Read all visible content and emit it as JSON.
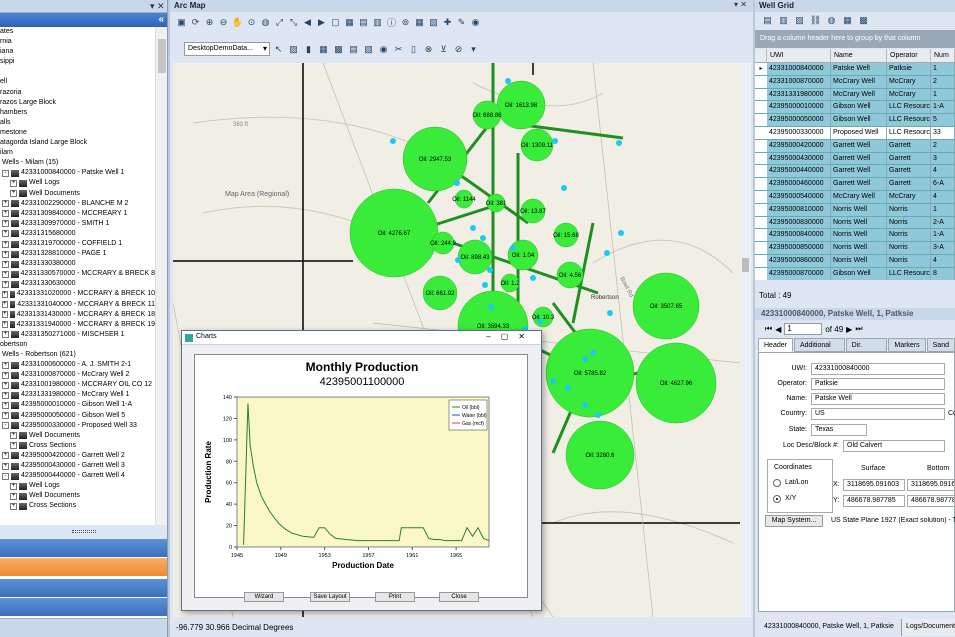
{
  "left_panel": {
    "tree_items": [
      {
        "text": "ates",
        "level": 0
      },
      {
        "text": "rnia",
        "level": 0
      },
      {
        "text": "iana",
        "level": 0
      },
      {
        "text": "sippi",
        "level": 0
      },
      {
        "text": "",
        "level": 0
      },
      {
        "text": "ell",
        "level": 0
      },
      {
        "text": "razoria",
        "level": 0
      },
      {
        "text": "razos Large Block",
        "level": 0
      },
      {
        "text": "hambers",
        "level": 0
      },
      {
        "text": "alls",
        "level": 0
      },
      {
        "text": "mestone",
        "level": 0
      },
      {
        "text": "atagorda Island Large Block",
        "level": 0
      },
      {
        "text": "ilam",
        "level": 0
      },
      {
        "text": "Wells - Milam (15)",
        "level": 1
      },
      {
        "text": "42331000840000 - Patske Well 1",
        "level": 1,
        "exp": "-"
      },
      {
        "text": "Well Logs",
        "level": 2,
        "exp": "+"
      },
      {
        "text": "Well Documents",
        "level": 2,
        "exp": "+"
      },
      {
        "text": "42331002290000 - BLANCHE M 2",
        "level": 1,
        "exp": "+"
      },
      {
        "text": "42331309840000 - MCCREARY 1",
        "level": 1,
        "exp": "+"
      },
      {
        "text": "42331309970000 - SMITH 1",
        "level": 1,
        "exp": "+"
      },
      {
        "text": "42331315680000",
        "level": 1,
        "exp": "+"
      },
      {
        "text": "42331319700000 - COFFIELD 1",
        "level": 1,
        "exp": "+"
      },
      {
        "text": "42331328810000 - PAGE 1",
        "level": 1,
        "exp": "+"
      },
      {
        "text": "42331330380000",
        "level": 1,
        "exp": "+"
      },
      {
        "text": "42331330570000 - MCCRARY & BRECK 8",
        "level": 1,
        "exp": "+"
      },
      {
        "text": "42331330630000",
        "level": 1,
        "exp": "+"
      },
      {
        "text": "42331331020000 - MCCRARY & BRECK 10",
        "level": 1,
        "exp": "+"
      },
      {
        "text": "42331331040000 - MCCRARY & BRECK 11",
        "level": 1,
        "exp": "+"
      },
      {
        "text": "42331331430000 - MCCRARY & BRECK 18",
        "level": 1,
        "exp": "+"
      },
      {
        "text": "42331331940000 - MCCRARY & BRECK 19",
        "level": 1,
        "exp": "+"
      },
      {
        "text": "42331350271000 - MISCHSER 1",
        "level": 1,
        "exp": "+"
      },
      {
        "text": "obertson",
        "level": 0
      },
      {
        "text": "Wells - Robertson (621)",
        "level": 1
      },
      {
        "text": "42331000600000 - A. J. SMITH 2-1",
        "level": 1,
        "exp": "+"
      },
      {
        "text": "42331000870000 - McCrary Well 2",
        "level": 1,
        "exp": "+"
      },
      {
        "text": "42331001980000 - MCCRARY OIL CO 12",
        "level": 1,
        "exp": "+"
      },
      {
        "text": "42331331980000 - McCrary Well 1",
        "level": 1,
        "exp": "+"
      },
      {
        "text": "42395000010000 - Gibson Well 1-A",
        "level": 1,
        "exp": "+"
      },
      {
        "text": "42395000050000 - Gibson Well 5",
        "level": 1,
        "exp": "+"
      },
      {
        "text": "42395000330000 - Proposed Well 33",
        "level": 1,
        "exp": "-"
      },
      {
        "text": "Well Documents",
        "level": 2,
        "exp": "+"
      },
      {
        "text": "Cross Sections",
        "level": 2,
        "exp": "+"
      },
      {
        "text": "42395000420000 - Garrett Well 2",
        "level": 1,
        "exp": "+"
      },
      {
        "text": "42395000430000 - Garrett Well 3",
        "level": 1,
        "exp": "+"
      },
      {
        "text": "42395000440000 - Garrett Well 4",
        "level": 1,
        "exp": "-"
      },
      {
        "text": "Well Logs",
        "level": 2,
        "exp": "+"
      },
      {
        "text": "Well Documents",
        "level": 2,
        "exp": "+"
      },
      {
        "text": "Cross Sections",
        "level": 2,
        "exp": "+"
      }
    ]
  },
  "map": {
    "title": "Arc Map",
    "layer_select": "DesktopDemoData...",
    "area_label": "Map Area (Regional)",
    "status": "-96.779 30.966 Decimal Degrees",
    "place_label": "Robertson",
    "road_labels": [
      "383 ft",
      "Bowl Rd"
    ],
    "bubbles": [
      {
        "label": "Oil: 1613.98",
        "r": 24
      },
      {
        "label": "Oil: 688.86",
        "r": 14
      },
      {
        "label": "Oil: 2947.53",
        "r": 32
      },
      {
        "label": "Oil: 1309.11",
        "r": 16
      },
      {
        "label": "Oil: 4276.67",
        "r": 44
      },
      {
        "label": "Oil: 13.87",
        "r": 12
      },
      {
        "label": "Oil: 15.68",
        "r": 12
      },
      {
        "label": "Oil: 244.9",
        "r": 11
      },
      {
        "label": "Oil: 898.43",
        "r": 17
      },
      {
        "label": "Oil: 1.04",
        "r": 15
      },
      {
        "label": "Oil: 4.56",
        "r": 13
      },
      {
        "label": "Oil: 661.02",
        "r": 17
      },
      {
        "label": "Oil: 3507.65",
        "r": 33
      },
      {
        "label": "Oil: 3594.33",
        "r": 35
      },
      {
        "label": "Oil: 5785.82",
        "r": 44
      },
      {
        "label": "Oil: 4627.96",
        "r": 40
      },
      {
        "label": "Oil: 3260.6",
        "r": 34
      },
      {
        "label": "Oil: 1144",
        "r": 9
      },
      {
        "label": "Oil: 381",
        "r": 9
      },
      {
        "label": "Oil: 1.2",
        "r": 9
      },
      {
        "label": "Oil: 10.3",
        "r": 10
      }
    ]
  },
  "chart_window": {
    "title": "Charts",
    "buttons": [
      "Wizard",
      "Save Layout",
      "Print",
      "Close"
    ]
  },
  "chart_data": {
    "type": "line",
    "title": "Monthly Production",
    "subtitle": "42395001100000",
    "xlabel": "Production Date",
    "ylabel": "Production Rate",
    "xlim": [
      1945,
      1968
    ],
    "ylim": [
      0,
      140
    ],
    "x_ticks": [
      "1945",
      "1949",
      "1953",
      "1957",
      "1961",
      "1965"
    ],
    "y_ticks": [
      0,
      20,
      40,
      60,
      80,
      100,
      120,
      140
    ],
    "legend": [
      "Oil (bbl)",
      "Water (bbl)",
      "Gas (mcf)"
    ],
    "series": [
      {
        "name": "Oil (bbl)",
        "color": "#2e7d32",
        "x": [
          1945.6,
          1946.0,
          1946.2,
          1946.5,
          1946.8,
          1947.2,
          1947.6,
          1948,
          1948.5,
          1949,
          1949.5,
          1950,
          1951,
          1952,
          1952.5,
          1953,
          1953.5,
          1954,
          1955,
          1956,
          1957,
          1958,
          1959,
          1959.8,
          1960,
          1961,
          1961.5,
          1962,
          1962.5,
          1963,
          1963.5,
          1964,
          1964.5,
          1965,
          1965.5,
          1966,
          1966.5,
          1967,
          1967.5,
          1968
        ],
        "y": [
          2,
          134,
          95,
          75,
          60,
          48,
          40,
          33,
          26,
          20,
          16,
          13,
          10,
          9,
          18,
          18,
          12,
          8,
          7,
          6,
          6,
          6,
          6,
          6,
          18,
          18,
          18,
          18,
          8,
          7,
          7,
          6,
          6,
          6,
          6,
          18,
          10,
          18,
          8,
          6
        ]
      }
    ]
  },
  "well_grid": {
    "title": "Well Grid",
    "group_hint": "Drag a column header here to group by that column",
    "columns": [
      "UWI",
      "Name",
      "Operator",
      "Num"
    ],
    "rows": [
      [
        "42331000840000",
        "Patske Well",
        "Patksie",
        "1"
      ],
      [
        "42331000870000",
        "McCrary Well",
        "McCrary",
        "2"
      ],
      [
        "42331331980000",
        "McCrary Well",
        "McCrary",
        "1"
      ],
      [
        "42395000010000",
        "Gibson Well",
        "LLC Resources",
        "1-A"
      ],
      [
        "42395000050000",
        "Gibson Well",
        "LLC Resources",
        "5"
      ],
      [
        "42395000330000",
        "Proposed Well",
        "LLC Resources",
        "33"
      ],
      [
        "42395000420000",
        "Garrett Well",
        "Garrett",
        "2"
      ],
      [
        "42395000430000",
        "Garrett Well",
        "Garrett",
        "3"
      ],
      [
        "42395000440000",
        "Garrett Well",
        "Garrett",
        "4"
      ],
      [
        "42395000460000",
        "Garrett Well",
        "Garrett",
        "6-A"
      ],
      [
        "42395000540000",
        "McCrary Well",
        "McCrary",
        "4"
      ],
      [
        "42395000810000",
        "Norris Well",
        "Norris",
        "1"
      ],
      [
        "42395000830000",
        "Norris Well",
        "Norris",
        "2-A"
      ],
      [
        "42395000840000",
        "Norris Well",
        "Norris",
        "1-A"
      ],
      [
        "42395000850000",
        "Norris Well",
        "Norris",
        "3-A"
      ],
      [
        "42395000860000",
        "Norris Well",
        "Norris",
        "4"
      ],
      [
        "42395000870000",
        "Gibson Well",
        "LLC Resources",
        "8"
      ]
    ],
    "total": "Total : 49"
  },
  "detail": {
    "title": "42331000840000, Patske Well, 1, Patksie",
    "nav_value": "1",
    "nav_of": "of 49",
    "tabs": [
      "Header",
      "Additional Info",
      "Dir. Survey",
      "Markers",
      "Sand"
    ],
    "fields": [
      {
        "label": "UWI:",
        "value": "42331000840000"
      },
      {
        "label": "Operator:",
        "value": "Patksie"
      },
      {
        "label": "Name:",
        "value": "Patske Well"
      },
      {
        "label": "Country:",
        "value": "US"
      },
      {
        "label": "State:",
        "value": "Texas"
      }
    ],
    "country_extra": "Co",
    "loc_label": "Loc Desc/Block #:",
    "loc_value": "Old Calvert",
    "coords_title": "Coordinates",
    "radio_latlon": "Lat/Lon",
    "radio_xy": "X/Y",
    "surface_label": "Surface",
    "bottom_label": "Bottom",
    "x_label": "X:",
    "y_label": "Y:",
    "x_surface": "3118695.091603",
    "x_bottom": "3118695.0916",
    "y_surface": "486678.987785",
    "y_bottom": "486678.98778",
    "map_system_button": "Map System...",
    "map_system_value": "US State Plane 1927 (Exact solution) - T",
    "status_left": "42331000840000, Patske Well, 1, Patksie",
    "status_right": "Logs/Document"
  }
}
